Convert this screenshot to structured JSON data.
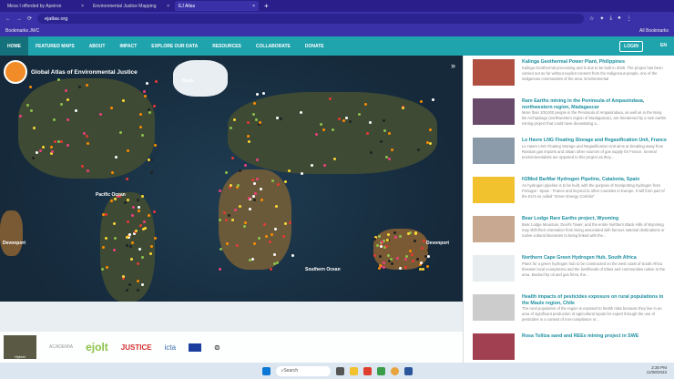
{
  "browser": {
    "tabs": [
      {
        "label": "Mess I offorded by Apeiron"
      },
      {
        "label": "Environmental Justice Mapping"
      },
      {
        "label": "EJ Atlas"
      }
    ],
    "url": "ejatlas.org",
    "bookmarks": "Bookmarks JWC",
    "all_bookmarks": "All Bookmarks"
  },
  "nav": {
    "items": [
      "HOME",
      "FEATURED MAPS",
      "ABOUT",
      "IMPACT",
      "EXPLORE OUR DATA",
      "RESOURCES",
      "COLLABORATE",
      "DONATE"
    ],
    "login": "LOGIN",
    "lang": "EN"
  },
  "map": {
    "title": "Global Atlas of Environmental Justice",
    "labels": [
      "Nuuk",
      "Pacific Ocean",
      "Southern Ocean",
      "Devonport",
      "Devonport"
    ],
    "layer": "Hybrid",
    "partners": [
      "ACADEMIA",
      "ejolt",
      "JUSTICE",
      "icta"
    ]
  },
  "sidebar": {
    "items": [
      {
        "title": "Kalinga Geothermal Power Plant, Philippines",
        "desc": "Kalinga Geothermal processing and is due to be built in 2026. The project has been carried out so far without explicit consent from the Indigenous people, one of the indigenous communities of the area. Environmental"
      },
      {
        "title": "Rare Earths mining in the Peninsula of Ampasindava, northwestern region, Madagascar",
        "desc": "More than 100,000 people in the Peninsula of Ampasindava, as well as in the Nosy Be Archipelago (northwestern region of Madagascar), are threatened by a rare earths mining project that could have devastating a..."
      },
      {
        "title": "Le Havre LNG Floating Storage and Regasification Unit, France",
        "desc": "Le Havre LNG Floating Storage and Regasification Unit aims at breaking away from Russian gas imports and obtain other sources of gas supply for France. Several environmentalists are opposed to this project as they..."
      },
      {
        "title": "H2Med BarMar Hydrogen Pipeline, Catalonia, Spain",
        "desc": "An hydrogen pipeline is to be built, with the purpose of transporting hydrogen from Portugal - Spain - France and beyond to other countries in Europe. It will form part of the EU's so called \"Green Energy Corridor\""
      },
      {
        "title": "Bear Lodge Rare Earths project, Wyoming",
        "desc": "Bear Lodge Mountain, Devil's Tower, and the entire Northern Black Hills of Wyoming may shift their orientation from being associated with famous national destinations or native cultural itineraries to being linked with the..."
      },
      {
        "title": "Northern Cape Green Hydrogen Hub, South Africa",
        "desc": "Plans for a green hydrogen hub to be constructed on the west coast of South Africa threaten local ecosystems and the livelihoods of tribes and communities native to the area. Backed by oil and gas firms, the..."
      },
      {
        "title": "Health impacts of pesticides exposure on rural populations in the Maule region, Chile",
        "desc": "The rural population of the region is exposed to health risks because they live in an area of significant production of agricultural inputs for export through the use of pesticides in a context of non-compliance or..."
      },
      {
        "title": "Rosa Tolliza sand and REEs mining project in SWE",
        "desc": ""
      }
    ]
  },
  "taskbar": {
    "search": "Search",
    "time": "2:30 PM",
    "date": "11/08/2023"
  },
  "colors": {
    "nav": "#1fa3ad",
    "link": "#1c8fa0",
    "browser": "#3a31a8"
  }
}
